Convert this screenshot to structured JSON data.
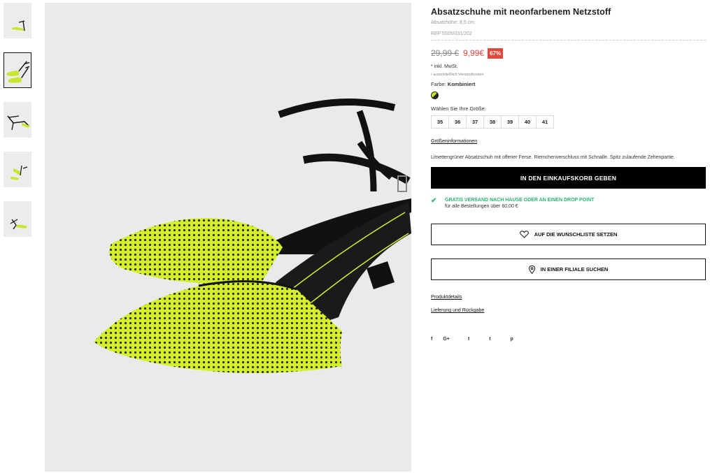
{
  "product": {
    "title": "Absatzschuhe mit neonfarbenem Netzstoff",
    "heel_height": "Absatzhöhe: 8,5 cm.",
    "ref": "REF 5505/031/202",
    "old_price": "29,99 €",
    "new_price": "9,99€",
    "discount": "67%",
    "tax": "* inkl. MwSt.",
    "shipping_note": "/ ausschließlich Versandkosten",
    "color_label": "Farbe:",
    "color_value": "Kombiniert",
    "size_label": "Wählen Sie Ihre Größe:",
    "sizes": [
      "35",
      "36",
      "37",
      "38",
      "39",
      "40",
      "41"
    ],
    "size_info_link": "Größeninformationen",
    "description": "Limettengrüner Absatzschuh mit offener Ferse. Riemchenverschluss mit Schnalle. Spitz zulaufende Zehenpartie."
  },
  "actions": {
    "add_to_cart": "IN DEN EINKAUFSKORB GEBEN",
    "free_shipping_title": "GRATIS VERSAND NACH HAUSE ODER AN EINEN DROP POINT",
    "free_shipping_sub": "für alle Bestellungen über 60,00 €",
    "wishlist": "AUF DIE WUNSCHLISTE SETZEN",
    "find_store": "IN EINER FILIALE SUCHEN"
  },
  "links": {
    "product_details": "Produktdetails",
    "delivery_returns": "Lieferung und Rückgabe"
  },
  "social": {
    "facebook": "f",
    "google": "G+",
    "twitter": "t",
    "tumblr": "t",
    "pinterest": "p"
  },
  "colors": {
    "neon": "#c8e62c",
    "sale_red": "#e2493c",
    "success_green": "#2bb673",
    "black": "#000000"
  },
  "icons": {
    "check": "check-icon",
    "heart": "heart-icon",
    "location": "location-pin-icon"
  }
}
